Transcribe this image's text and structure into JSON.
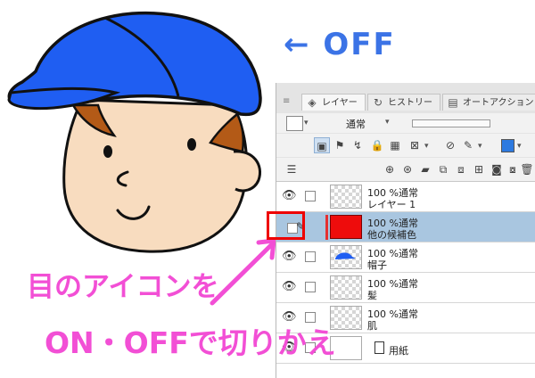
{
  "annotations": {
    "off_label": "← OFF",
    "pink_line1": "目のアイコンを",
    "pink_line2": "ON・OFFで切りかえ"
  },
  "panel": {
    "tabs": [
      {
        "label": "レイヤー",
        "icon": "layers-icon",
        "active": true
      },
      {
        "label": "ヒストリー",
        "icon": "history-icon",
        "active": false
      },
      {
        "label": "オートアクション",
        "icon": "auto-action-icon",
        "active": false
      }
    ],
    "blend_mode": "通常",
    "toolbar_color": "#2d7ae0"
  },
  "layers": [
    {
      "opacity": "100 %",
      "mode": "通常",
      "name": "レイヤー 1",
      "visible": true,
      "thumb": "transparent"
    },
    {
      "opacity": "100 %",
      "mode": "通常",
      "name": "他の候補色",
      "visible": false,
      "thumb": "red",
      "selected": true
    },
    {
      "opacity": "100 %",
      "mode": "通常",
      "name": "帽子",
      "visible": true,
      "thumb": "transparent"
    },
    {
      "opacity": "100 %",
      "mode": "通常",
      "name": "髪",
      "visible": true,
      "thumb": "transparent"
    },
    {
      "opacity": "100 %",
      "mode": "通常",
      "name": "肌",
      "visible": true,
      "thumb": "transparent"
    },
    {
      "opacity": "",
      "mode": "",
      "name": "用紙",
      "visible": true,
      "thumb": "white"
    }
  ],
  "colors": {
    "cap": "#1f5ef2",
    "skin": "#f8dcbf",
    "hair": "#b35a17",
    "annotation_blue": "#3b73e6",
    "annotation_pink": "#f24fd5",
    "highlight": "#ee0000",
    "selected_row": "#a9c6e0"
  }
}
